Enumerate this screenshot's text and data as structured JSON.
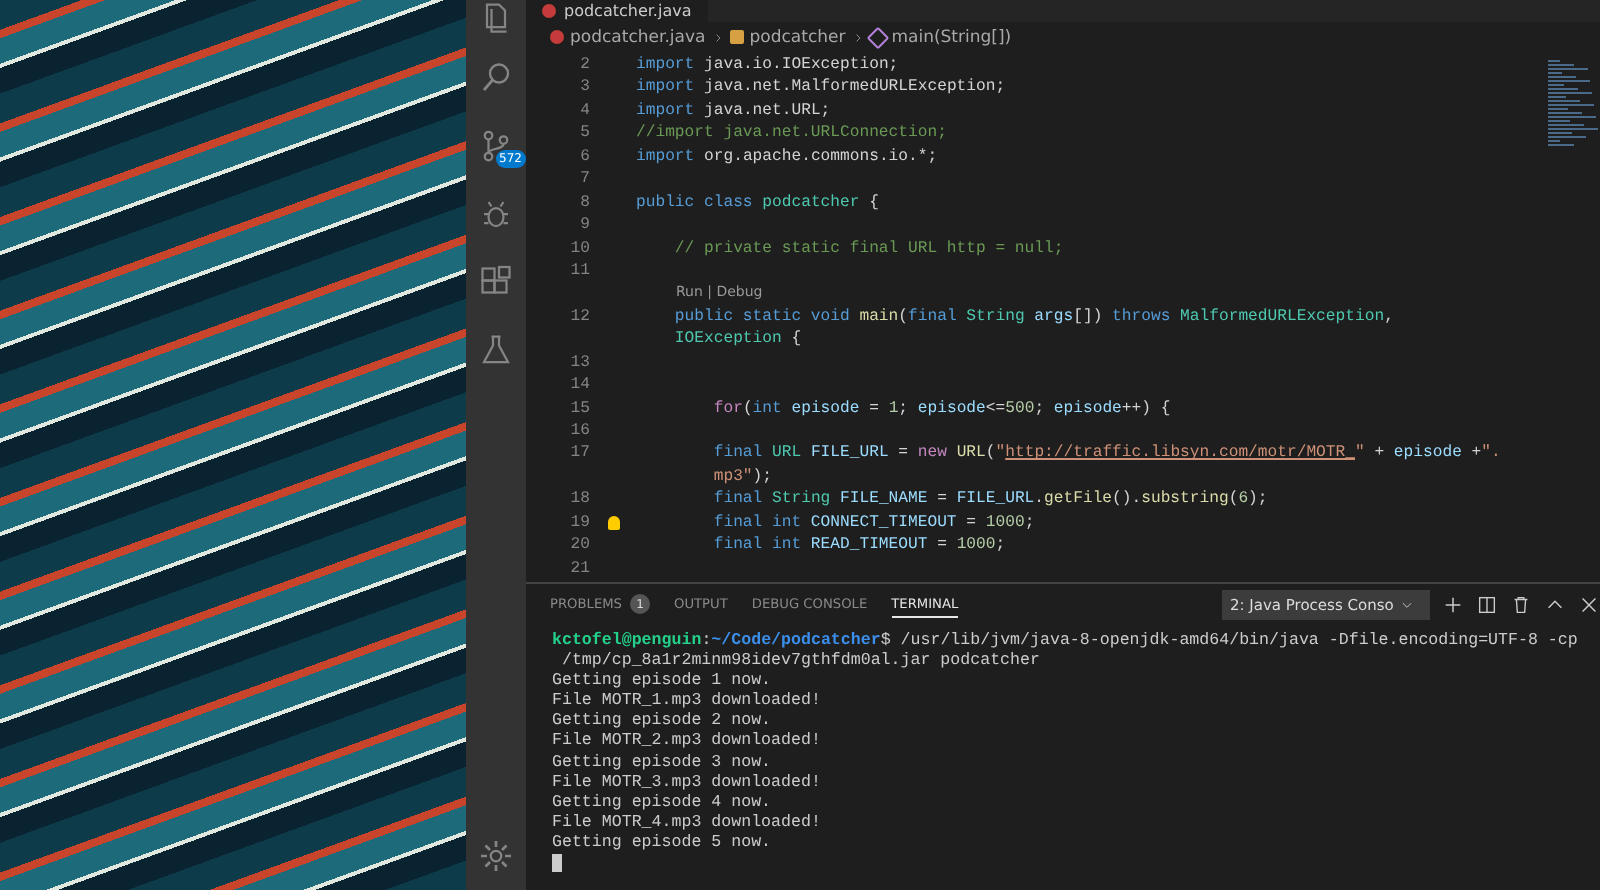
{
  "photo": {
    "kind": "photo"
  },
  "activity_bar": {
    "items": [
      {
        "selected": false
      },
      {
        "selected": false
      },
      {
        "selected": false,
        "badge": "572"
      },
      {
        "selected": false
      },
      {
        "selected": false
      },
      {
        "selected": false
      }
    ]
  },
  "tab": {
    "label": "podcatcher.java",
    "selected": true
  },
  "breadcrumb": [
    "podcatcher.java",
    "podcatcher",
    "main(String[])"
  ],
  "code_lines": [
    {
      "number": "2",
      "tokens": [
        {
          "text": "import",
          "kind": "kw"
        },
        {
          "text": " java.io.IOException;",
          "kind": "plain"
        }
      ]
    },
    {
      "number": "3",
      "tokens": [
        {
          "text": "import",
          "kind": "kw"
        },
        {
          "text": " java.net.MalformedURLException;",
          "kind": "plain"
        }
      ]
    },
    {
      "number": "4",
      "tokens": [
        {
          "text": "import",
          "kind": "kw"
        },
        {
          "text": " java.net.URL;",
          "kind": "plain"
        }
      ]
    },
    {
      "number": "5",
      "tokens": [
        {
          "text": "//import java.net.URLConnection;",
          "kind": "com"
        }
      ]
    },
    {
      "number": "6",
      "tokens": [
        {
          "text": "import",
          "kind": "kw"
        },
        {
          "text": " org.apache.commons.io.*;",
          "kind": "plain"
        }
      ]
    },
    {
      "number": "7"
    },
    {
      "number": "8",
      "tokens": [
        {
          "text": "public class",
          "kind": "kw"
        },
        {
          "text": " podcatcher",
          "kind": "type"
        },
        {
          "text": " {",
          "kind": "plain"
        }
      ]
    },
    {
      "number": "9"
    },
    {
      "number": "10",
      "tokens": [
        {
          "text": "    // private static final URL http = null;",
          "kind": "com"
        }
      ]
    },
    {
      "number": "11"
    },
    {
      "lens": "Run | Debug"
    },
    {
      "number": "12",
      "tokens": [
        {
          "text": "    public static void",
          "kind": "kw"
        },
        {
          "text": " main",
          "kind": "fn"
        },
        {
          "text": "(",
          "kind": "plain"
        },
        {
          "text": "final",
          "kind": "kw"
        },
        {
          "text": " String",
          "kind": "type"
        },
        {
          "text": " args",
          "kind": "var"
        },
        {
          "text": "[]) ",
          "kind": "plain"
        },
        {
          "text": "throws",
          "kind": "kw"
        },
        {
          "text": " MalformedURLException",
          "kind": "type"
        },
        {
          "text": ",",
          "kind": "plain"
        }
      ]
    },
    {
      "tokens": [
        {
          "text": "    IOException",
          "kind": "type"
        },
        {
          "text": " {",
          "kind": "plain"
        }
      ]
    },
    {
      "number": "13"
    },
    {
      "number": "14"
    },
    {
      "number": "15",
      "tokens": [
        {
          "text": "        for",
          "kind": "ctl"
        },
        {
          "text": "(",
          "kind": "plain"
        },
        {
          "text": "int",
          "kind": "kw"
        },
        {
          "text": " episode",
          "kind": "var"
        },
        {
          "text": " = ",
          "kind": "plain"
        },
        {
          "text": "1",
          "kind": "num"
        },
        {
          "text": "; ",
          "kind": "plain"
        },
        {
          "text": "episode",
          "kind": "var"
        },
        {
          "text": "<=",
          "kind": "plain"
        },
        {
          "text": "500",
          "kind": "num"
        },
        {
          "text": "; ",
          "kind": "plain"
        },
        {
          "text": "episode",
          "kind": "var"
        },
        {
          "text": "++) {",
          "kind": "plain"
        }
      ]
    },
    {
      "number": "16"
    },
    {
      "number": "17",
      "tokens": [
        {
          "text": "        final",
          "kind": "kw"
        },
        {
          "text": " URL",
          "kind": "type"
        },
        {
          "text": " FILE_URL",
          "kind": "var"
        },
        {
          "text": " = ",
          "kind": "plain"
        },
        {
          "text": "new",
          "kind": "ctl"
        },
        {
          "text": " URL",
          "kind": "fn"
        },
        {
          "text": "(",
          "kind": "plain"
        },
        {
          "text": "\"",
          "kind": "str"
        },
        {
          "text": "http://traffic.libsyn.com/motr/MOTR_",
          "kind": "link"
        },
        {
          "text": "\"",
          "kind": "str"
        },
        {
          "text": " + ",
          "kind": "plain"
        },
        {
          "text": "episode",
          "kind": "var"
        },
        {
          "text": " +",
          "kind": "plain"
        },
        {
          "text": "\".",
          "kind": "str"
        }
      ]
    },
    {
      "tokens": [
        {
          "text": "        mp3\"",
          "kind": "str"
        },
        {
          "text": ");",
          "kind": "plain"
        }
      ]
    },
    {
      "number": "18",
      "tokens": [
        {
          "text": "        final",
          "kind": "kw"
        },
        {
          "text": " String",
          "kind": "type"
        },
        {
          "text": " FILE_NAME",
          "kind": "var"
        },
        {
          "text": " = ",
          "kind": "plain"
        },
        {
          "text": "FILE_URL",
          "kind": "var"
        },
        {
          "text": ".",
          "kind": "plain"
        },
        {
          "text": "getFile",
          "kind": "fn"
        },
        {
          "text": "().",
          "kind": "plain"
        },
        {
          "text": "substring",
          "kind": "fn"
        },
        {
          "text": "(",
          "kind": "plain"
        },
        {
          "text": "6",
          "kind": "num"
        },
        {
          "text": ");",
          "kind": "plain"
        }
      ]
    },
    {
      "number": "19",
      "hint": true,
      "tokens": [
        {
          "text": "        final int",
          "kind": "kw"
        },
        {
          "text": " CONNECT_TIMEOUT",
          "kind": "var"
        },
        {
          "text": " = ",
          "kind": "plain"
        },
        {
          "text": "1000",
          "kind": "num"
        },
        {
          "text": ";",
          "kind": "plain"
        }
      ]
    },
    {
      "number": "20",
      "tokens": [
        {
          "text": "        final int",
          "kind": "kw"
        },
        {
          "text": " READ_TIMEOUT",
          "kind": "var"
        },
        {
          "text": " = ",
          "kind": "plain"
        },
        {
          "text": "1000",
          "kind": "num"
        },
        {
          "text": ";",
          "kind": "plain"
        }
      ]
    },
    {
      "number": "21"
    }
  ],
  "panel": {
    "tabs": [
      {
        "label": "PROBLEMS",
        "badge": "1",
        "selected": false
      },
      {
        "label": "OUTPUT",
        "selected": false
      },
      {
        "label": "DEBUG CONSOLE",
        "selected": false
      },
      {
        "label": "TERMINAL",
        "selected": true
      }
    ],
    "dropdown": "2: Java Process Conso"
  },
  "terminal": {
    "prompt": {
      "user": "kctofel@penguin",
      "separator": ":",
      "path": "~/Code/podcatcher",
      "command": "$ /usr/lib/jvm/java-8-openjdk-amd64/bin/java -Dfile.encoding=UTF-8 -cp"
    },
    "lines": [
      " /tmp/cp_8a1r2minm98idev7gthfdm0al.jar podcatcher",
      "Getting episode 1 now.",
      "File MOTR_1.mp3 downloaded!",
      "Getting episode 2 now.",
      "File MOTR_2.mp3 downloaded!",
      "Getting episode 3 now.",
      "File MOTR_3.mp3 downloaded!",
      "Getting episode 4 now.",
      "File MOTR_4.mp3 downloaded!",
      "Getting episode 5 now."
    ]
  }
}
